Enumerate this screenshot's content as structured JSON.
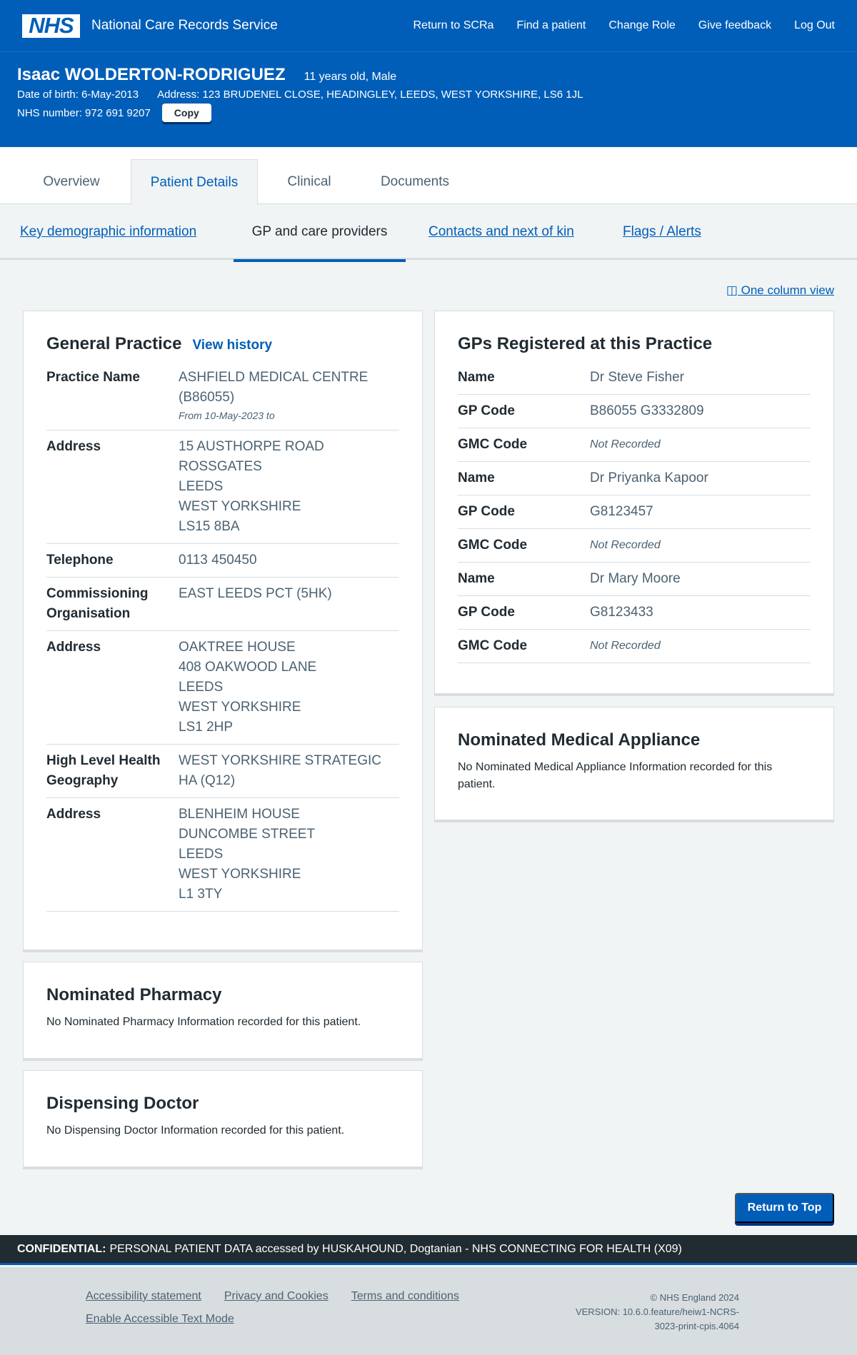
{
  "header": {
    "logo": "NHS",
    "service": "National Care Records Service",
    "nav": [
      "Return to SCRa",
      "Find a patient",
      "Change Role",
      "Give feedback",
      "Log Out"
    ]
  },
  "patient": {
    "name": "Isaac WOLDERTON-RODRIGUEZ",
    "age_sex": "11 years old, Male",
    "dob": "Date of birth: 6-May-2013",
    "address": "Address: 123 BRUDENEL CLOSE, HEADINGLEY, LEEDS, WEST YORKSHIRE, LS6 1JL",
    "nhs_number": "NHS number: 972 691 9207",
    "copy_label": "Copy"
  },
  "tabs": [
    "Overview",
    "Patient Details",
    "Clinical",
    "Documents"
  ],
  "subtabs": [
    "Key demographic information",
    "GP and care providers",
    "Contacts and next of kin",
    "Flags / Alerts"
  ],
  "one_column_view": "◫ One column view",
  "general_practice": {
    "title": "General Practice",
    "view_history": "View history",
    "rows": [
      {
        "key": "Practice Name",
        "lines": [
          "ASHFIELD MEDICAL CENTRE",
          "(B86055)"
        ],
        "sub": "From 10-May-2023 to"
      },
      {
        "key": "Address",
        "lines": [
          "15 AUSTHORPE ROAD",
          "ROSSGATES",
          "LEEDS",
          "WEST YORKSHIRE",
          "LS15 8BA"
        ]
      },
      {
        "key": "Telephone",
        "lines": [
          "0113 450450"
        ]
      },
      {
        "key": "Commissioning Organisation",
        "lines": [
          "EAST LEEDS PCT (5HK)"
        ]
      },
      {
        "key": "Address",
        "lines": [
          "OAKTREE HOUSE",
          "408 OAKWOOD LANE",
          "LEEDS",
          "WEST YORKSHIRE",
          "LS1 2HP"
        ]
      },
      {
        "key": "High Level Health Geography",
        "lines": [
          "WEST YORKSHIRE STRATEGIC",
          "HA (Q12)"
        ]
      },
      {
        "key": "Address",
        "lines": [
          "BLENHEIM HOUSE",
          "DUNCOMBE STREET",
          "LEEDS",
          "WEST YORKSHIRE",
          "L1 3TY"
        ]
      }
    ]
  },
  "gps_registered": {
    "title": "GPs Registered at this Practice",
    "rows": [
      {
        "key": "Name",
        "value": "Dr Steve Fisher"
      },
      {
        "key": "GP Code",
        "value": "B86055 G3332809"
      },
      {
        "key": "GMC Code",
        "value": "Not Recorded",
        "nr": true
      },
      {
        "key": "Name",
        "value": "Dr Priyanka Kapoor"
      },
      {
        "key": "GP Code",
        "value": "G8123457"
      },
      {
        "key": "GMC Code",
        "value": "Not Recorded",
        "nr": true
      },
      {
        "key": "Name",
        "value": "Dr Mary Moore"
      },
      {
        "key": "GP Code",
        "value": "G8123433"
      },
      {
        "key": "GMC Code",
        "value": "Not Recorded",
        "nr": true
      }
    ]
  },
  "nominated_appliance": {
    "title": "Nominated Medical Appliance",
    "text": "No Nominated Medical Appliance Information recorded for this patient."
  },
  "nominated_pharmacy": {
    "title": "Nominated Pharmacy",
    "text": "No Nominated Pharmacy Information recorded for this patient."
  },
  "dispensing_doctor": {
    "title": "Dispensing Doctor",
    "text": "No Dispensing Doctor Information recorded for this patient."
  },
  "return_top": "Return to Top",
  "confidential": {
    "label": "CONFIDENTIAL:",
    "text": "PERSONAL PATIENT DATA accessed by HUSKAHOUND, Dogtanian - NHS CONNECTING FOR HEALTH (X09)"
  },
  "footer": {
    "links": [
      "Accessibility statement",
      "Privacy and Cookies",
      "Terms and conditions",
      "Enable Accessible Text Mode"
    ],
    "copyright": "© NHS England 2024",
    "version": "VERSION: 10.6.0.feature/heiw1-NCRS-3023-print-cpis.4064"
  }
}
